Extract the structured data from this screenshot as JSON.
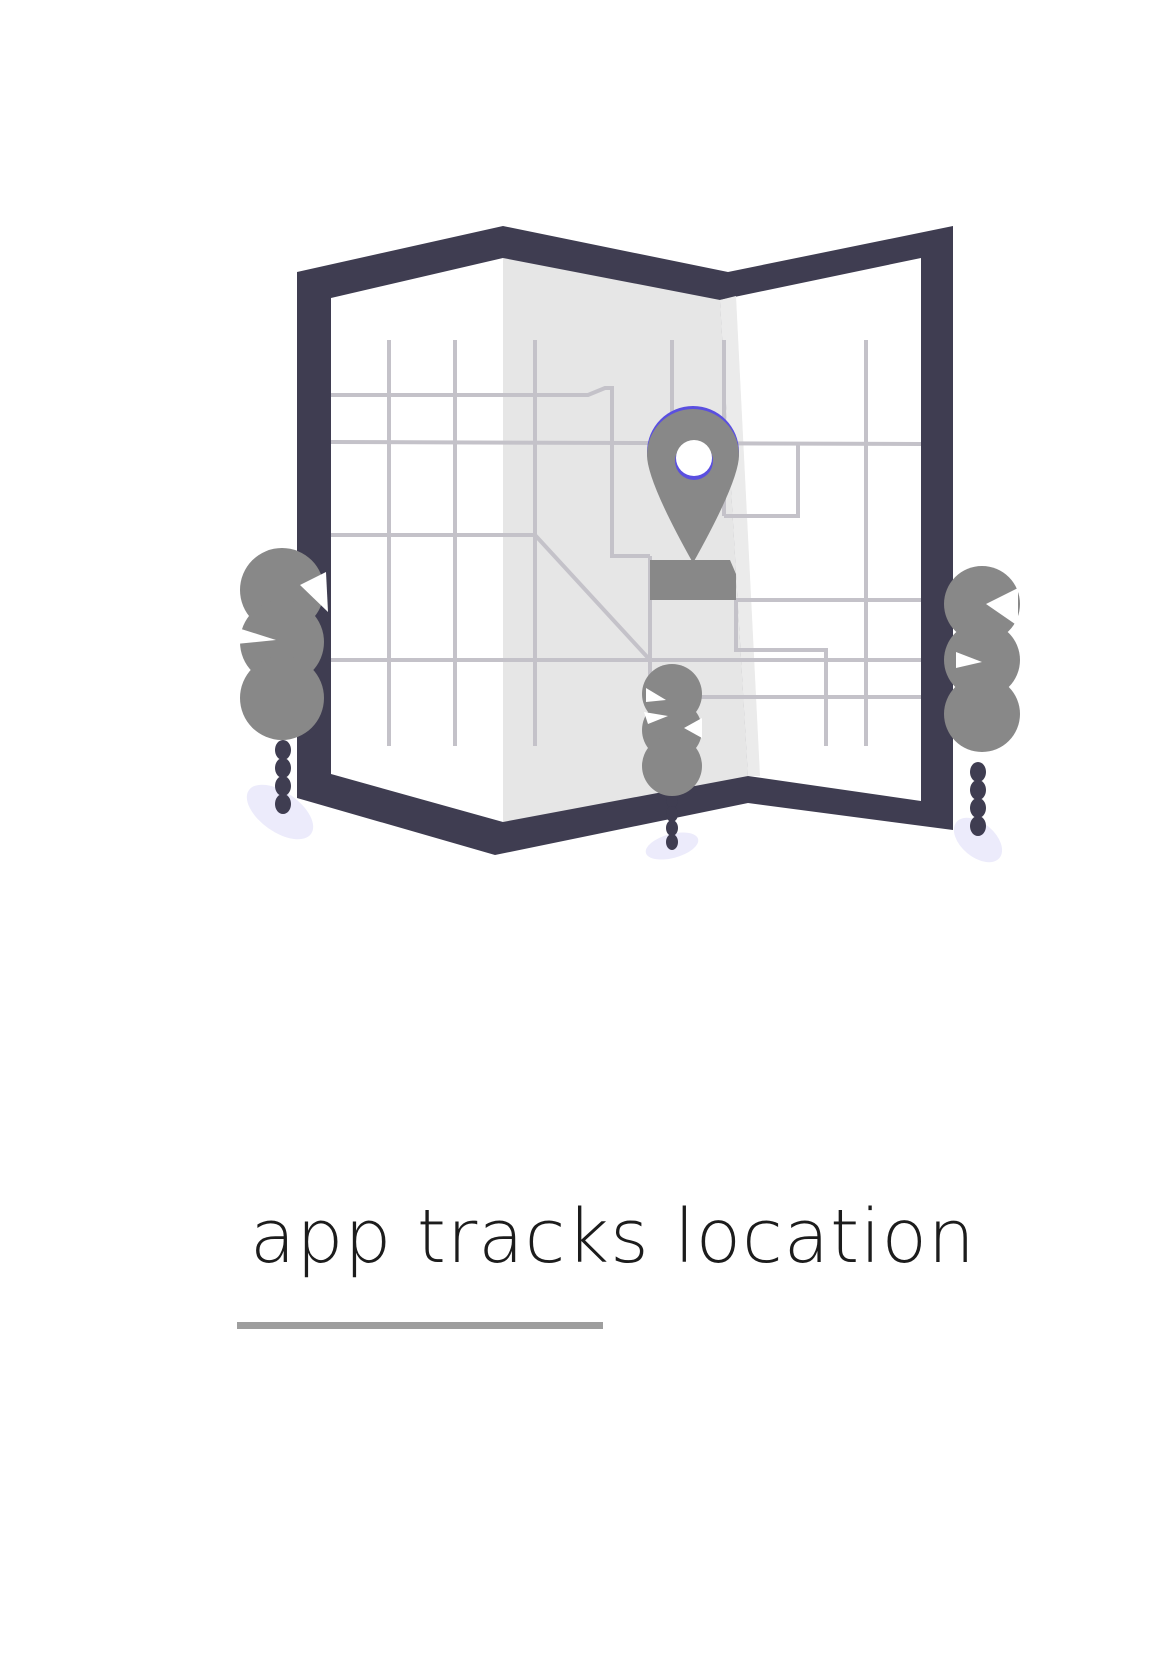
{
  "screen": {
    "caption": "app tracks location"
  },
  "icons": {
    "map": "folded-map-icon",
    "pin": "location-pin-icon",
    "tree": "tree-icon"
  },
  "colors": {
    "background": "#ffffff",
    "map_frame": "#3f3d51",
    "map_paper": "#ffffff",
    "map_fold": "#e6e6e6",
    "roads": "#c4c2c9",
    "pin": "#888888",
    "pin_accent": "#5a4fe0",
    "trees": "#888888",
    "tree_trunks": "#3f3d51",
    "tree_shadows": "#ecebfb",
    "caption_text": "#1c1c1c",
    "divider": "#9e9e9e"
  }
}
